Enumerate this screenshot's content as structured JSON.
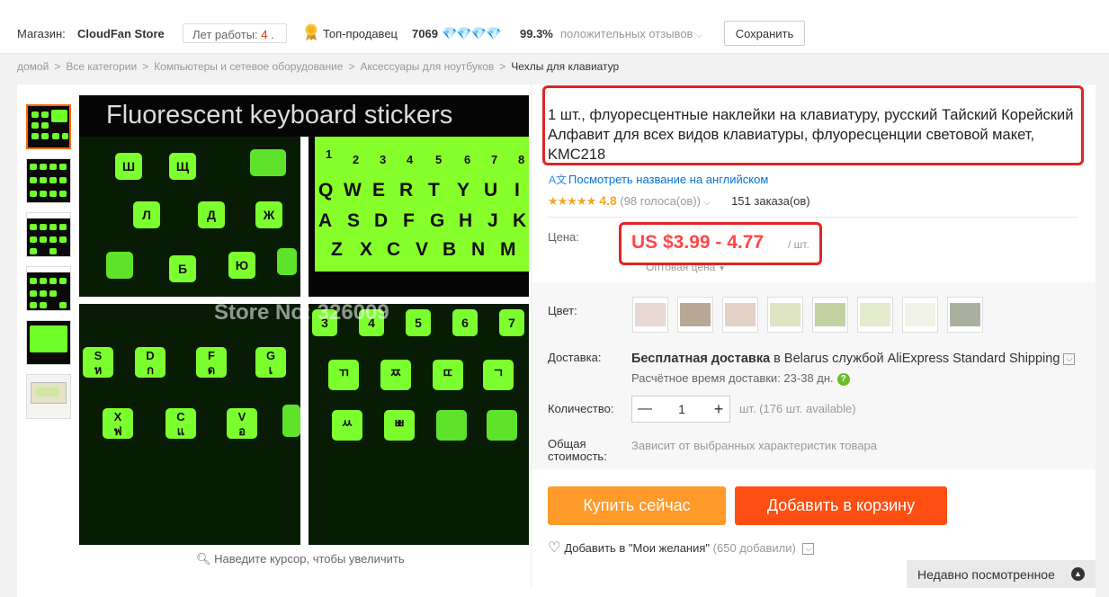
{
  "store": {
    "label": "Магазин:",
    "name": "CloudFan Store",
    "years_label": "Лет работы:",
    "years_value": "4",
    "years_suffix": ".",
    "top_seller": "Топ-продавец",
    "score": "7069",
    "positive_pct": "99.3%",
    "positive_label": "положительных отзывов",
    "save_label": "Сохранить"
  },
  "breadcrumb": [
    "домой",
    "Все категории",
    "Компьютеры и сетевое оборудование",
    "Аксессуары для ноутбуков",
    "Чехлы для клавиатур"
  ],
  "gallery": {
    "image_title": "Fluorescent keyboard stickers",
    "watermark": "Store No: 326009",
    "zoom_hint": "Наведите курсор, чтобы увеличить",
    "keys_top_left": [
      "Ш",
      "Щ",
      "Л",
      "Д",
      "Ж",
      "Б",
      "Ю"
    ],
    "keys_top_right": [
      "Q",
      "W",
      "E",
      "R",
      "T",
      "Y",
      "U",
      "I",
      "A",
      "S",
      "D",
      "F",
      "G",
      "H",
      "J",
      "K",
      "Z",
      "X",
      "C",
      "V",
      "B",
      "N",
      "M"
    ],
    "top_right_nums": [
      "1",
      "2",
      "3",
      "4",
      "5",
      "6",
      "7",
      "8"
    ],
    "keys_bottom_left": [
      "S",
      "D",
      "F",
      "G",
      "X",
      "C",
      "V"
    ],
    "keys_bottom_left_thai": [
      "ห",
      "ก",
      "ด",
      "เ",
      "ฟ",
      "แ",
      "อ",
      "ฃ"
    ],
    "keys_bottom_right_num": [
      "3",
      "4",
      "5",
      "6",
      "7"
    ],
    "keys_bottom_right_kr": [
      "ㄲ",
      "ㅉ",
      "ㄸ",
      "ㄱ",
      "ㅆ",
      "ㅃ"
    ]
  },
  "product": {
    "title": "1 шт., флуоресцентные наклейки на клавиатуру, русский Тайский Корейский Алфавит для всех видов клавиатуры, флуоресценции световой макет, KMC218",
    "translate_link": "Посмотреть название на английском",
    "rating_value": "4.8",
    "votes": "(98 голоса(ов))",
    "orders": "151 заказа(ов)",
    "price_label": "Цена:",
    "price": "US $3.99 - 4.77",
    "per_unit": "/ шт.",
    "wholesale": "Оптовая цена",
    "color_label": "Цвет:",
    "shipping_label": "Доставка:",
    "shipping_free": "Бесплатная доставка",
    "shipping_rest": " в Belarus службой AliExpress Standard Shipping",
    "shipping_est": "Расчётное время доставки: 23-38 дн.",
    "qty_label": "Количество:",
    "qty_value": "1",
    "qty_avail": "шт. (176 шт. available)",
    "total_label_1": "Общая",
    "total_label_2": "стоимость:",
    "total_note": "Зависит от выбранных характеристик товара",
    "buy_now": "Купить сейчас",
    "add_cart": "Добавить в корзину",
    "wishlist": "Добавить в \"Мои желания\"",
    "wish_count": "(650 добавили)"
  },
  "recent": "Недавно посмотренное",
  "colors": {
    "accent": "#ff4747",
    "buy": "#ff9a2b",
    "cart": "#ff4e12",
    "highlight": "#e22424"
  }
}
